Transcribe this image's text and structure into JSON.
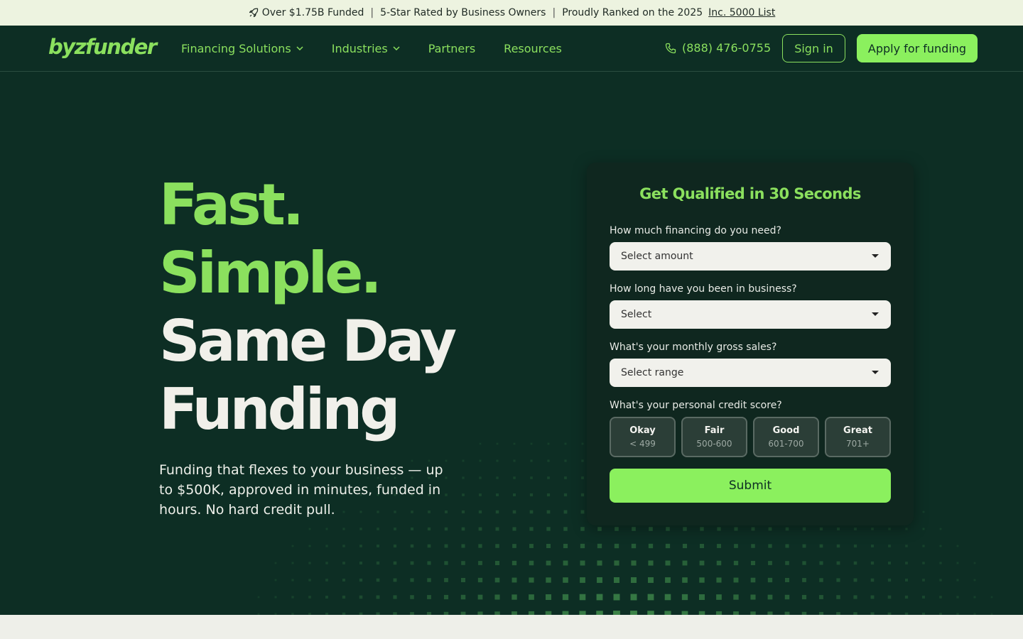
{
  "topbar": {
    "funded": "Over $1.75B Funded",
    "rated": "5-Star Rated by Business Owners",
    "ranked": "Proudly Ranked on the 2025",
    "ranked_link": "Inc. 5000 List",
    "separator": "|",
    "icon": "rocket-icon"
  },
  "nav": {
    "logo": "byzfunder",
    "menu": [
      {
        "label": "Financing Solutions",
        "dropdown": true
      },
      {
        "label": "Industries",
        "dropdown": true
      },
      {
        "label": "Partners",
        "dropdown": false
      },
      {
        "label": "Resources",
        "dropdown": false
      }
    ],
    "phone": "(888) 476-0755",
    "signin": "Sign in",
    "apply": "Apply for funding"
  },
  "hero": {
    "line1": "Fast.",
    "line2": "Simple.",
    "line3": "Same Day",
    "line4": "Funding",
    "subtext": "Funding that flexes to your business — up to $500K, approved in minutes, funded in hours. No hard credit pull."
  },
  "form": {
    "title": "Get Qualified in 30 Seconds",
    "q1": "How much financing do you need?",
    "q1_value": "Select amount",
    "q2": "How long have you been in business?",
    "q2_value": "Select",
    "q3": "What's your monthly gross sales?",
    "q3_value": "Select range",
    "q4": "What's your personal credit score?",
    "credit_options": [
      {
        "title": "Okay",
        "range": "< 499"
      },
      {
        "title": "Fair",
        "range": "500-600"
      },
      {
        "title": "Good",
        "range": "601-700"
      },
      {
        "title": "Great",
        "range": "701+"
      }
    ],
    "submit": "Submit"
  },
  "colors": {
    "accent": "#8bf05e",
    "background": "#0d2e24",
    "card": "#0f271f",
    "topbar": "#edf3e0"
  }
}
